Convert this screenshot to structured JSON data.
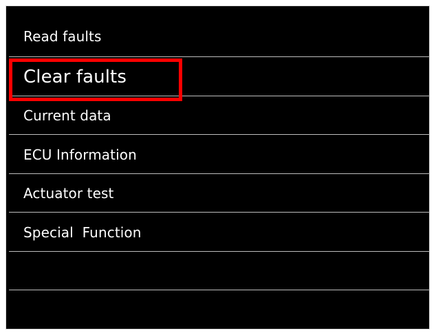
{
  "menu": {
    "items": [
      {
        "label": "Read faults"
      },
      {
        "label": "Clear faults"
      },
      {
        "label": "Current data"
      },
      {
        "label": "ECU Information"
      },
      {
        "label": "Actuator test"
      },
      {
        "label": "Special  Function"
      },
      {
        "label": ""
      },
      {
        "label": ""
      }
    ]
  },
  "highlight": {
    "target": "Clear faults",
    "color": "#ff0000"
  },
  "colors": {
    "background": "#000000",
    "text": "#ffffff",
    "divider": "#bfbfbf",
    "frame": "#d8d8d8"
  }
}
